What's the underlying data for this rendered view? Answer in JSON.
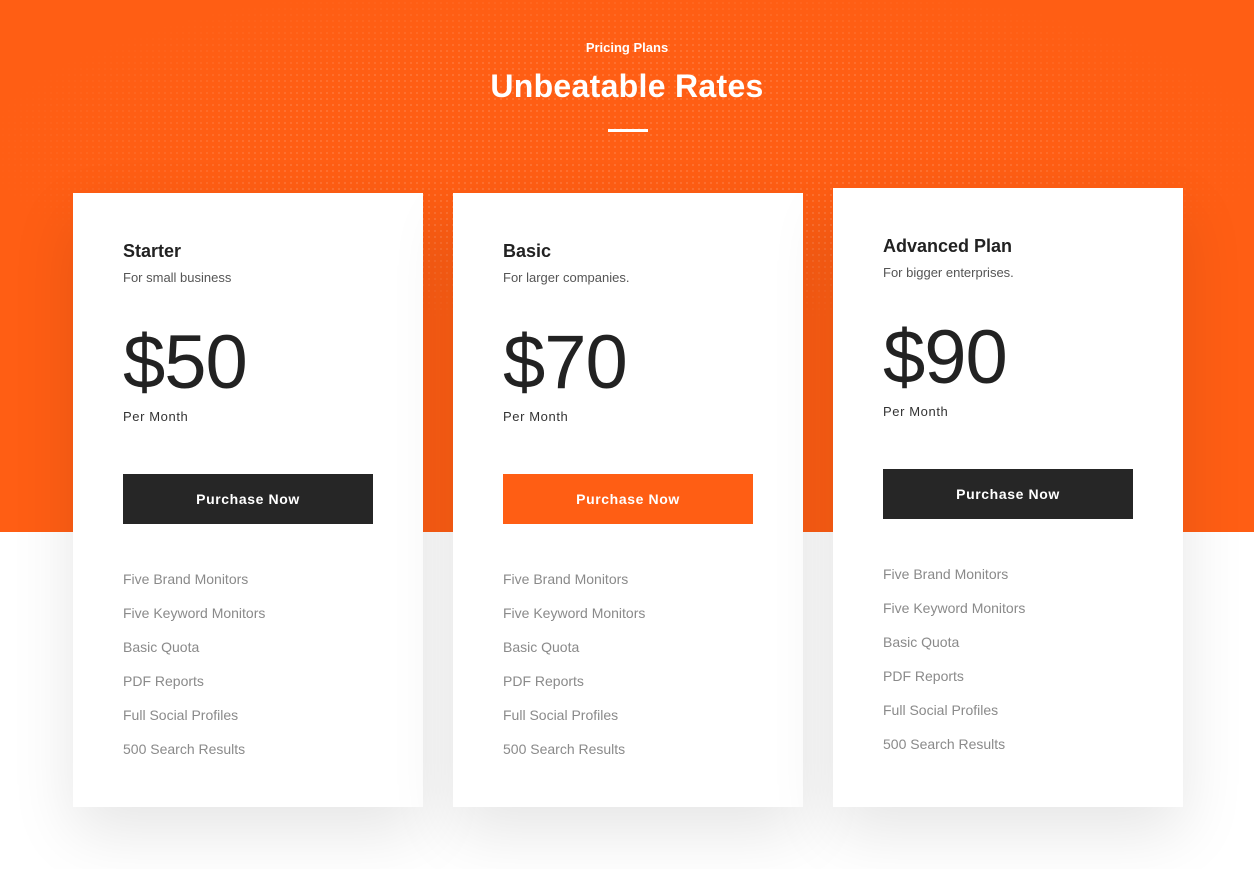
{
  "header": {
    "eyebrow": "Pricing Plans",
    "title": "Unbeatable Rates"
  },
  "colors": {
    "accent": "#ff5e14",
    "dark": "#262626"
  },
  "plans": [
    {
      "name": "Starter",
      "description": "For small business",
      "price": "$50",
      "period": "Per Month",
      "cta": "Purchase Now",
      "cta_color": "#262626",
      "features": [
        "Five Brand Monitors",
        "Five Keyword Monitors",
        "Basic Quota",
        "PDF Reports",
        "Full Social Profiles",
        "500 Search Results"
      ]
    },
    {
      "name": "Basic",
      "description": "For larger companies.",
      "price": "$70",
      "period": "Per Month",
      "cta": "Purchase Now",
      "cta_color": "#ff5e14",
      "features": [
        "Five Brand Monitors",
        "Five Keyword Monitors",
        "Basic Quota",
        "PDF Reports",
        "Full Social Profiles",
        "500 Search Results"
      ]
    },
    {
      "name": "Advanced Plan",
      "description": "For bigger enterprises.",
      "price": "$90",
      "period": "Per Month",
      "cta": "Purchase Now",
      "cta_color": "#262626",
      "features": [
        "Five Brand Monitors",
        "Five Keyword Monitors",
        "Basic Quota",
        "PDF Reports",
        "Full Social Profiles",
        "500 Search Results"
      ]
    }
  ]
}
